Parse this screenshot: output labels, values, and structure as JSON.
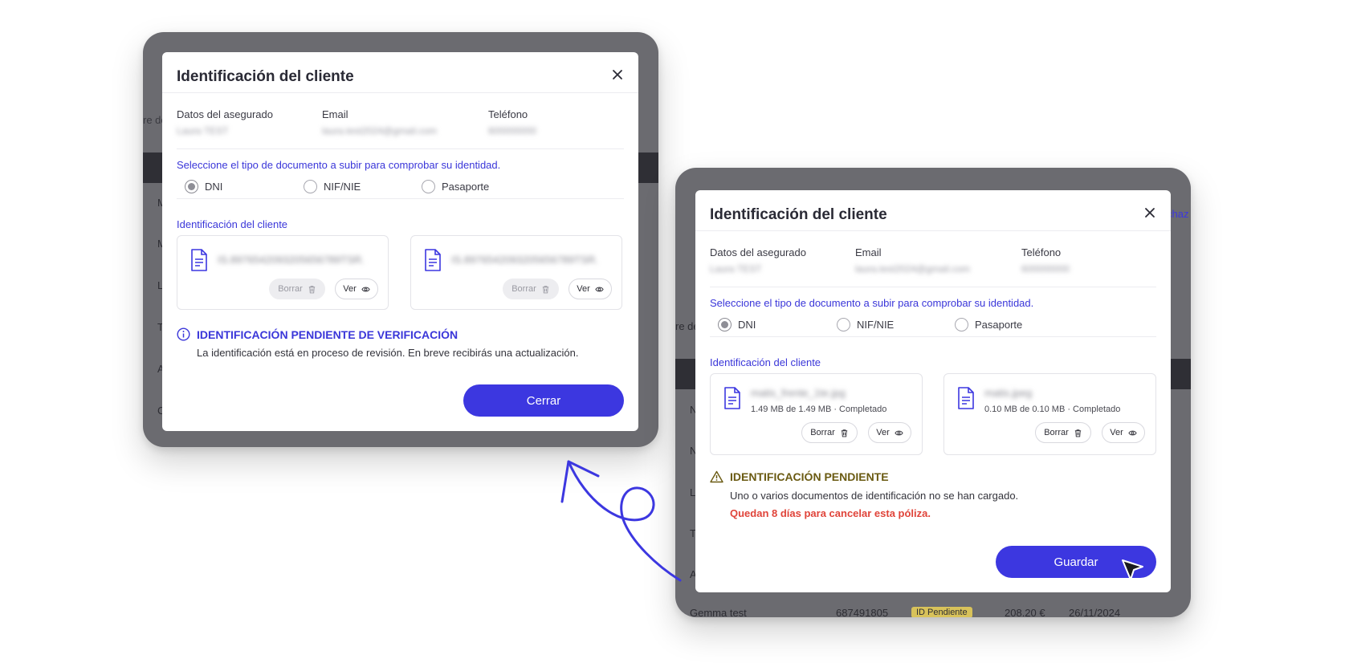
{
  "colors": {
    "accent": "#3c37e0",
    "accent_text": "#3a36d9",
    "warn": "#e0443a",
    "pending": "#6a5a12"
  },
  "left_bg": {
    "txt1": "re de",
    "rows": [
      "M",
      "M",
      "L",
      "T",
      "A",
      "C"
    ]
  },
  "right_bg": {
    "txt1": "re de",
    "link": "chaz",
    "rows": [
      "N",
      "N",
      "L",
      "T",
      "A"
    ],
    "bottom_row": {
      "name": "Gemma test",
      "id": "687491805",
      "badge": "ID Pendiente",
      "amount": "208.20 €",
      "date": "26/11/2024"
    }
  },
  "modal_left": {
    "title": "Identificación del cliente",
    "info": {
      "insured_label": "Datos del asegurado",
      "insured_value": "Laura TEST",
      "email_label": "Email",
      "email_value": "laura.test2024@gmail.com",
      "phone_label": "Teléfono",
      "phone_value": "600000000"
    },
    "instructions": "Seleccione el tipo de documento a subir para comprobar su identidad.",
    "radios": [
      "DNI",
      "NIF/NIE",
      "Pasaporte"
    ],
    "selected": "DNI",
    "section_label": "Identificación del cliente",
    "cards": [
      {
        "filename": "IS.8976542093205656789TSR.",
        "delete": "Borrar",
        "view": "Ver"
      },
      {
        "filename": "IS.8976542093205656789TSR.",
        "delete": "Borrar",
        "view": "Ver"
      }
    ],
    "status_title": "IDENTIFICACIÓN PENDIENTE DE VERIFICACIÓN",
    "status_desc": "La identificación está en proceso de revisión. En breve recibirás una actualización.",
    "button": "Cerrar"
  },
  "modal_right": {
    "title": "Identificación del cliente",
    "info": {
      "insured_label": "Datos del asegurado",
      "insured_value": "Laura TEST",
      "email_label": "Email",
      "email_value": "laura.test2024@gmail.com",
      "phone_label": "Teléfono",
      "phone_value": "600000000"
    },
    "instructions": "Seleccione el tipo de documento a subir para comprobar su identidad.",
    "radios": [
      "DNI",
      "NIF/NIE",
      "Pasaporte"
    ],
    "selected": "DNI",
    "section_label": "Identificación del cliente",
    "cards": [
      {
        "filename": "matis_frente_1te.jpg",
        "meta": "1.49 MB de 1.49 MB · Completado",
        "delete": "Borrar",
        "view": "Ver"
      },
      {
        "filename": "matis.jpeg",
        "meta": "0.10 MB de 0.10 MB · Completado",
        "delete": "Borrar",
        "view": "Ver"
      }
    ],
    "status_title": "IDENTIFICACIÓN PENDIENTE",
    "status_desc": "Uno o varios documentos de identificación no se han cargado.",
    "status_warning": "Quedan 8 días para cancelar esta póliza.",
    "button": "Guardar"
  }
}
